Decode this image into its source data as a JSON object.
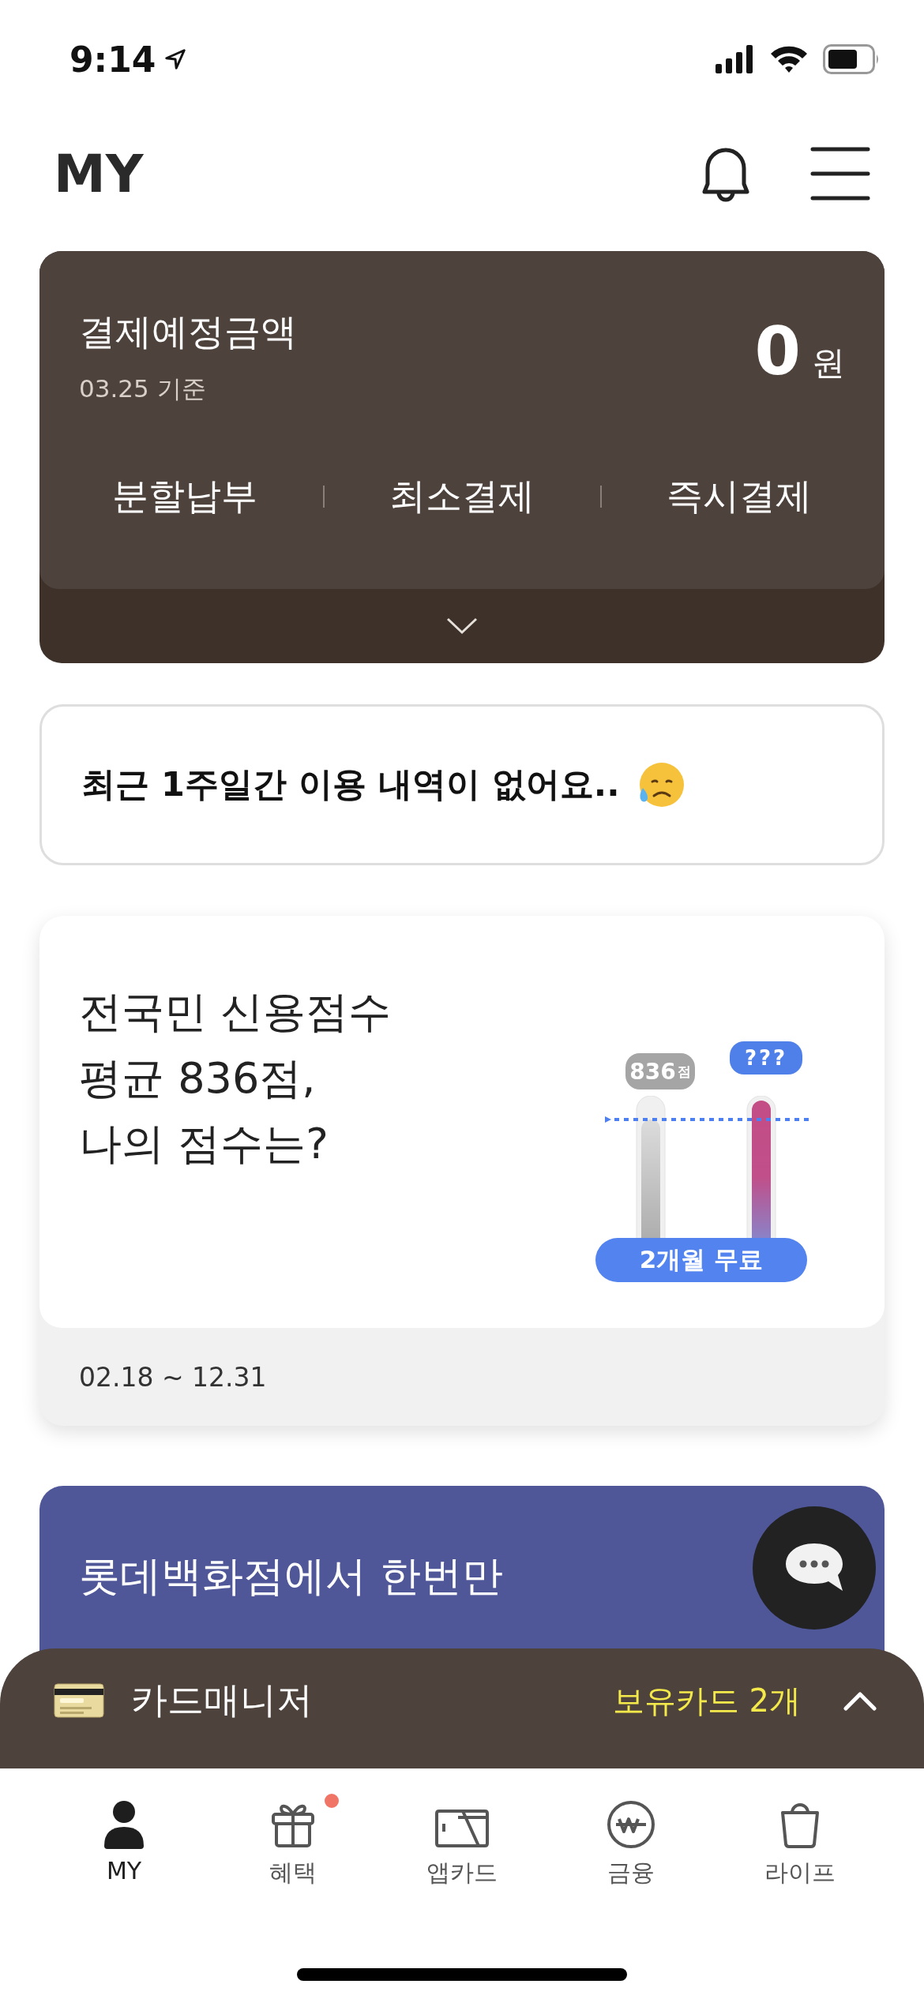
{
  "status_bar": {
    "time": "9:14"
  },
  "header": {
    "title": "MY"
  },
  "payment_card": {
    "title": "결제예정금액",
    "date": "03.25 기준",
    "amount": "0",
    "currency": "원",
    "actions": [
      "분할납부",
      "최소결제",
      "즉시결제"
    ]
  },
  "notice": {
    "text": "최근 1주일간 이용 내역이 없어요.."
  },
  "credit_promo": {
    "heading": [
      "전국민 신용점수",
      "평균 836점,",
      "나의 점수는?"
    ],
    "average_score": "836",
    "score_unit": "점",
    "unknown_score": "???",
    "badge": "2개월 무료",
    "period": "02.18 ~ 12.31"
  },
  "banner": {
    "text": "롯데백화점에서 한번만"
  },
  "card_manager": {
    "title": "카드매니저",
    "count": "보유카드 2개"
  },
  "tab_bar": [
    {
      "label": "MY",
      "selected": true,
      "badge": false
    },
    {
      "label": "혜택",
      "selected": false,
      "badge": true
    },
    {
      "label": "앱카드",
      "selected": false,
      "badge": false
    },
    {
      "label": "금융",
      "selected": false,
      "badge": false
    },
    {
      "label": "라이프",
      "selected": false,
      "badge": false
    }
  ]
}
